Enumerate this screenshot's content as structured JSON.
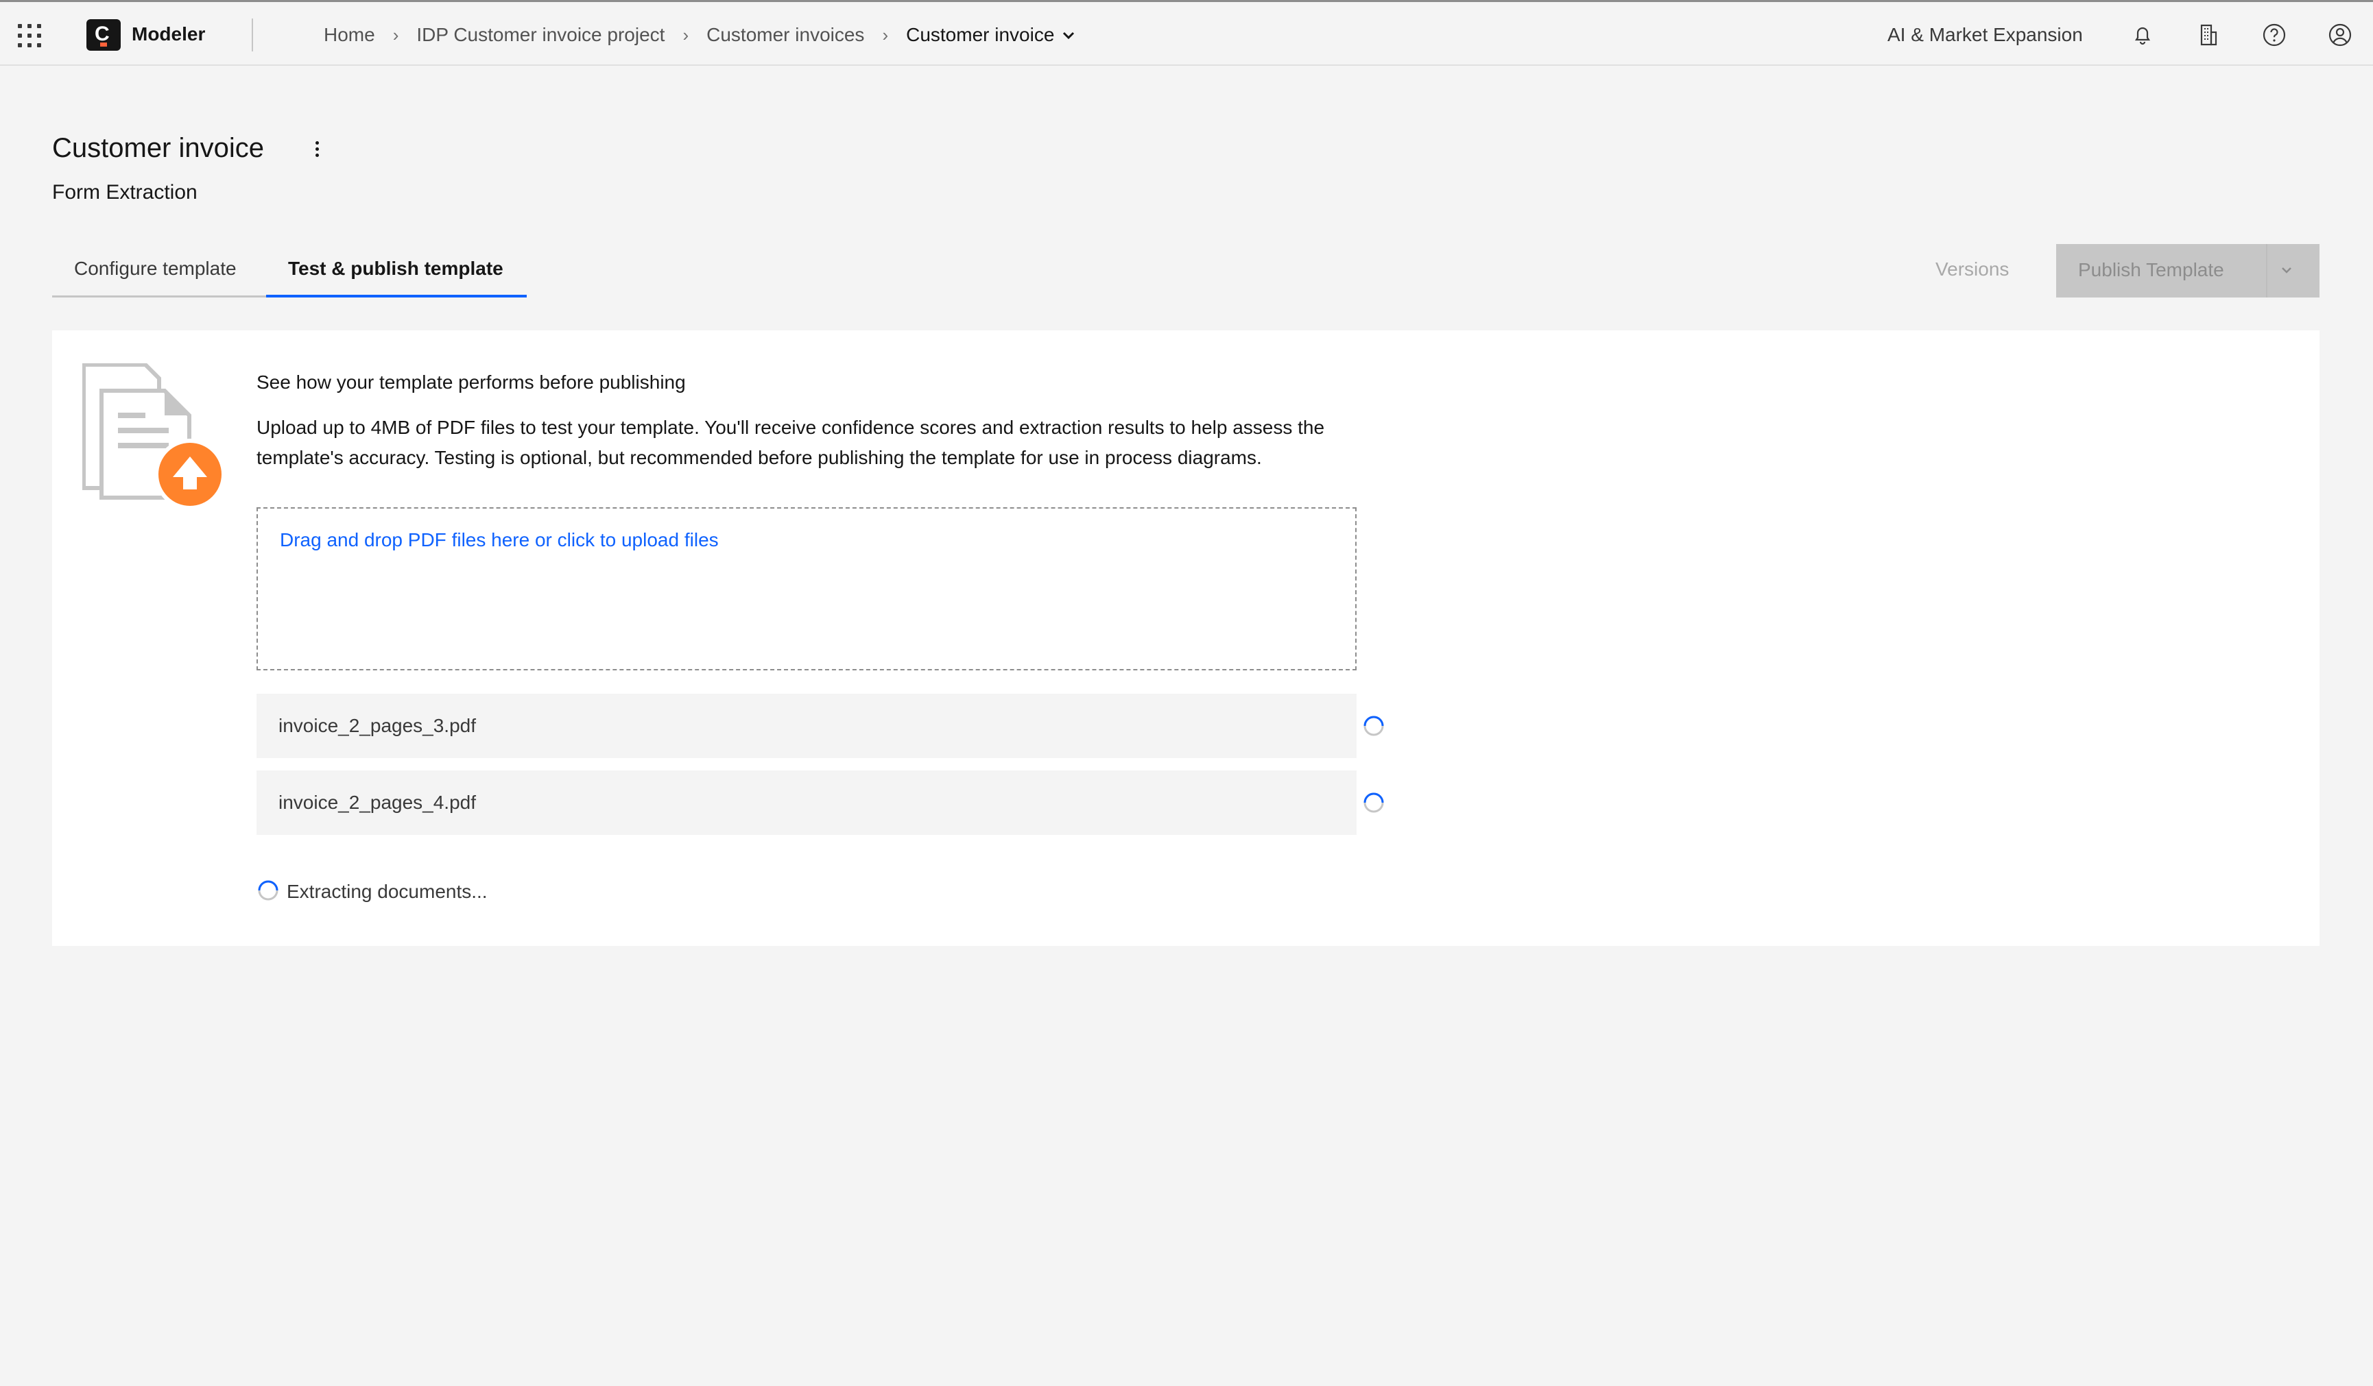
{
  "header": {
    "app_name": "Modeler",
    "breadcrumbs": [
      "Home",
      "IDP Customer invoice project",
      "Customer invoices",
      "Customer invoice"
    ],
    "org_name": "AI & Market Expansion",
    "icons": [
      "app-switcher-icon",
      "notification-icon",
      "organization-icon",
      "help-icon",
      "user-avatar-icon"
    ]
  },
  "page": {
    "title": "Customer invoice",
    "subtitle": "Form Extraction"
  },
  "tabs": [
    {
      "label": "Configure template",
      "active": false
    },
    {
      "label": "Test & publish template",
      "active": true
    }
  ],
  "actions": {
    "versions_label": "Versions",
    "publish_label": "Publish Template"
  },
  "test_panel": {
    "heading": "See how your template performs before publishing",
    "description": "Upload up to 4MB of PDF files to test your template. You'll receive confidence scores and extraction results to help assess the template's accuracy. Testing is optional, but recommended before publishing the template for use in process diagrams.",
    "dropzone_text": "Drag and drop PDF files here or click to upload files",
    "files": [
      {
        "name": "invoice_2_pages_3.pdf",
        "status": "loading"
      },
      {
        "name": "invoice_2_pages_4.pdf",
        "status": "loading"
      }
    ],
    "status_text": "Extracting documents..."
  },
  "colors": {
    "accent": "#0f62fe",
    "upload_badge": "#ff832b",
    "illustration_gray": "#c6c6c6"
  }
}
